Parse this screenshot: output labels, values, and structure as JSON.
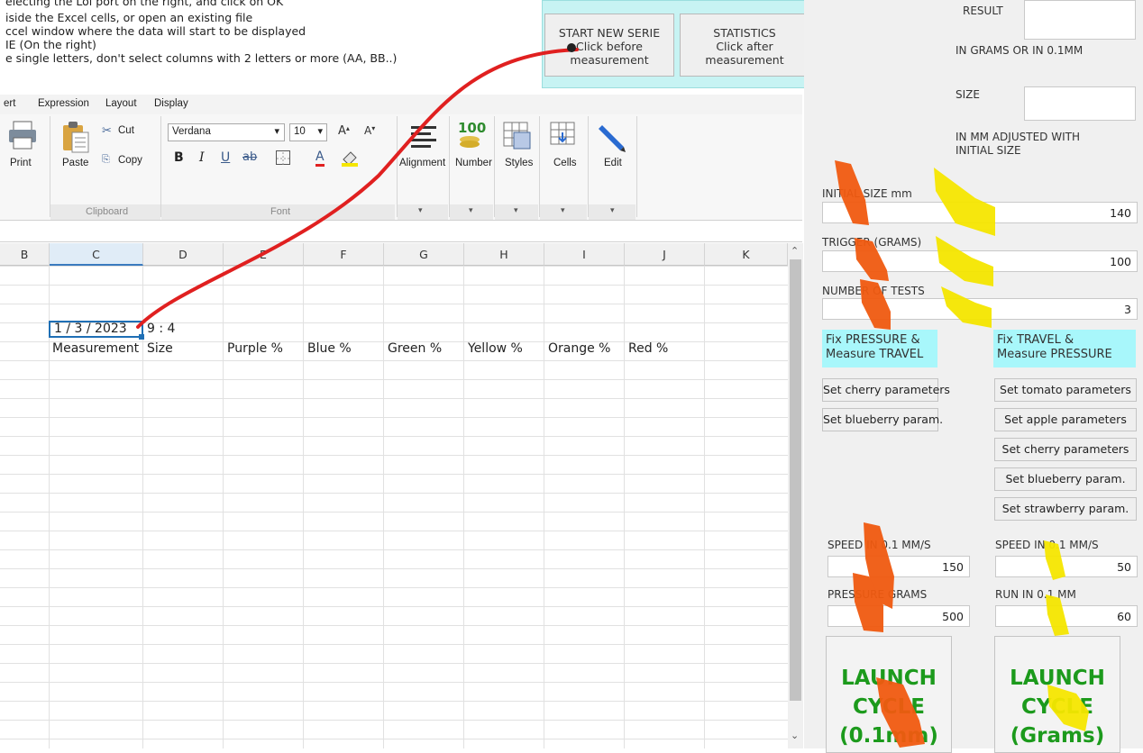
{
  "instructions": {
    "lines": [
      "electing the Lol port on the right, and click on OK",
      "iside the Excel cells, or open an existing file",
      "ccel window where the data will start to be displayed",
      "IE (On the right)",
      "e single letters, don't select columns with 2 letters or more (AA, BB..)"
    ]
  },
  "top_buttons": {
    "start_new_serie": {
      "title": "START NEW SERIE",
      "line2": "Click before",
      "line3": "measurement"
    },
    "statistics": {
      "title": "STATISTICS",
      "line2": "Click after",
      "line3": "measurement"
    }
  },
  "menu": {
    "items": [
      "ert",
      "Expression",
      "Layout",
      "Display"
    ]
  },
  "ribbon": {
    "print": "Print",
    "paste": "Paste",
    "cut": "Cut",
    "copy": "Copy",
    "clipboard_group": "Clipboard",
    "font_name": "Verdana",
    "font_size": "10",
    "font_group": "Font",
    "bold": "B",
    "italic": "I",
    "underline": "U",
    "strike": "ab",
    "font_color_letter": "A",
    "grow_font": "A",
    "shrink_font": "A",
    "alignment": "Alignment",
    "number": "Number",
    "number_glyph": "100",
    "styles": "Styles",
    "cells": "Cells",
    "edit": "Edit",
    "dropdown_caret": "▾"
  },
  "grid": {
    "columns": [
      "B",
      "C",
      "D",
      "E",
      "F",
      "G",
      "H",
      "I",
      "J",
      "K"
    ],
    "selected_column": "C",
    "date_cell": "1 / 3 / 2023",
    "time_cell": "9 : 4",
    "header_row": [
      "Measurement",
      "Size",
      "Purple %",
      "Blue %",
      "Green %",
      "Yellow %",
      "Orange %",
      "Red %"
    ]
  },
  "right_panel": {
    "result_label": "RESULT",
    "result_units": "IN GRAMS OR IN 0.1MM",
    "size_label": "SIZE",
    "size_note_1": "IN MM ADJUSTED WITH",
    "size_note_2": "INITIAL SIZE",
    "initial_size_label": "INITIAL SIZE mm",
    "initial_size_value": "140",
    "trigger_label": "TRIGGER (GRAMS)",
    "trigger_value": "100",
    "tests_label": "NUMBER OF TESTS",
    "tests_value": "3",
    "fix_pressure_1": "Fix PRESSURE &",
    "fix_pressure_2": "Measure TRAVEL",
    "fix_travel_1": "Fix TRAVEL &",
    "fix_travel_2": "Measure PRESSURE",
    "left_params": [
      "Set cherry parameters",
      "Set blueberry param."
    ],
    "right_params": [
      "Set tomato parameters",
      "Set apple parameters",
      "Set cherry parameters",
      "Set blueberry param.",
      "Set strawberry param."
    ],
    "speed_left_label": "SPEED IN 0.1 MM/S",
    "speed_left_value": "150",
    "pressure_label": "PRESSURE GRAMS",
    "pressure_value": "500",
    "speed_right_label": "SPEED IN 0.1 MM/S",
    "speed_right_value": "50",
    "run_label": "RUN IN 0.1 MM",
    "run_value": "60",
    "launch_left": [
      "LAUNCH",
      "CYCLE",
      "(0.1mm)"
    ],
    "launch_right": [
      "LAUNCH",
      "CYCLE",
      "(Grams)"
    ]
  },
  "colors": {
    "panel_cyan": "#c7f3f3",
    "label_cyan": "#a8f7fb",
    "launch_green": "#1c9a1c",
    "annotation_red": "#e02020",
    "annotation_orange": "#f05a10",
    "annotation_yellow": "#f5e600"
  }
}
